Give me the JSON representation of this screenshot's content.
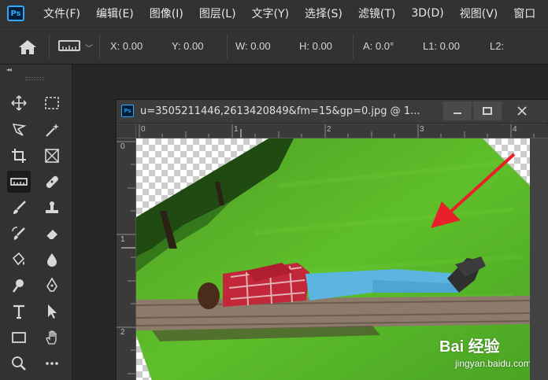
{
  "app": {
    "logo_text": "Ps"
  },
  "menu": [
    "文件(F)",
    "编辑(E)",
    "图像(I)",
    "图层(L)",
    "文字(Y)",
    "选择(S)",
    "滤镜(T)",
    "3D(D)",
    "视图(V)",
    "窗口"
  ],
  "options_bar": {
    "x": "X: 0.00",
    "y": "Y: 0.00",
    "w": "W: 0.00",
    "h": "H: 0.00",
    "a": "A: 0.0°",
    "l1": "L1: 0.00",
    "l2": "L2:"
  },
  "toolbar": {
    "collapse": "◂◂",
    "tools": [
      "move-icon",
      "marquee-icon",
      "lasso-icon",
      "magic-wand-icon",
      "crop-icon",
      "frame-icon",
      "ruler-icon",
      "healing-brush-icon",
      "brush-icon",
      "clone-stamp-icon",
      "history-brush-icon",
      "eraser-icon",
      "paint-bucket-icon",
      "blur-icon",
      "dodge-icon",
      "pen-icon",
      "type-icon",
      "path-selection-icon",
      "rectangle-icon",
      "hand-icon",
      "zoom-icon",
      "more-tools-icon"
    ],
    "active_tool": "ruler-icon"
  },
  "document": {
    "logo_text": "Ps",
    "title": "u=3505211446,2613420849&fm=15&gp=0.jpg @ 1...",
    "ruler_h": [
      "0",
      "1",
      "2",
      "3",
      "4"
    ],
    "ruler_v": [
      "0",
      "1",
      "2"
    ],
    "watermark": "Bai 经验",
    "watermark_url": "jingyan.baidu.com"
  },
  "colors": {
    "accent": "#31a8ff",
    "arrow": "#e8202a",
    "grass": "#5fbf2a"
  }
}
